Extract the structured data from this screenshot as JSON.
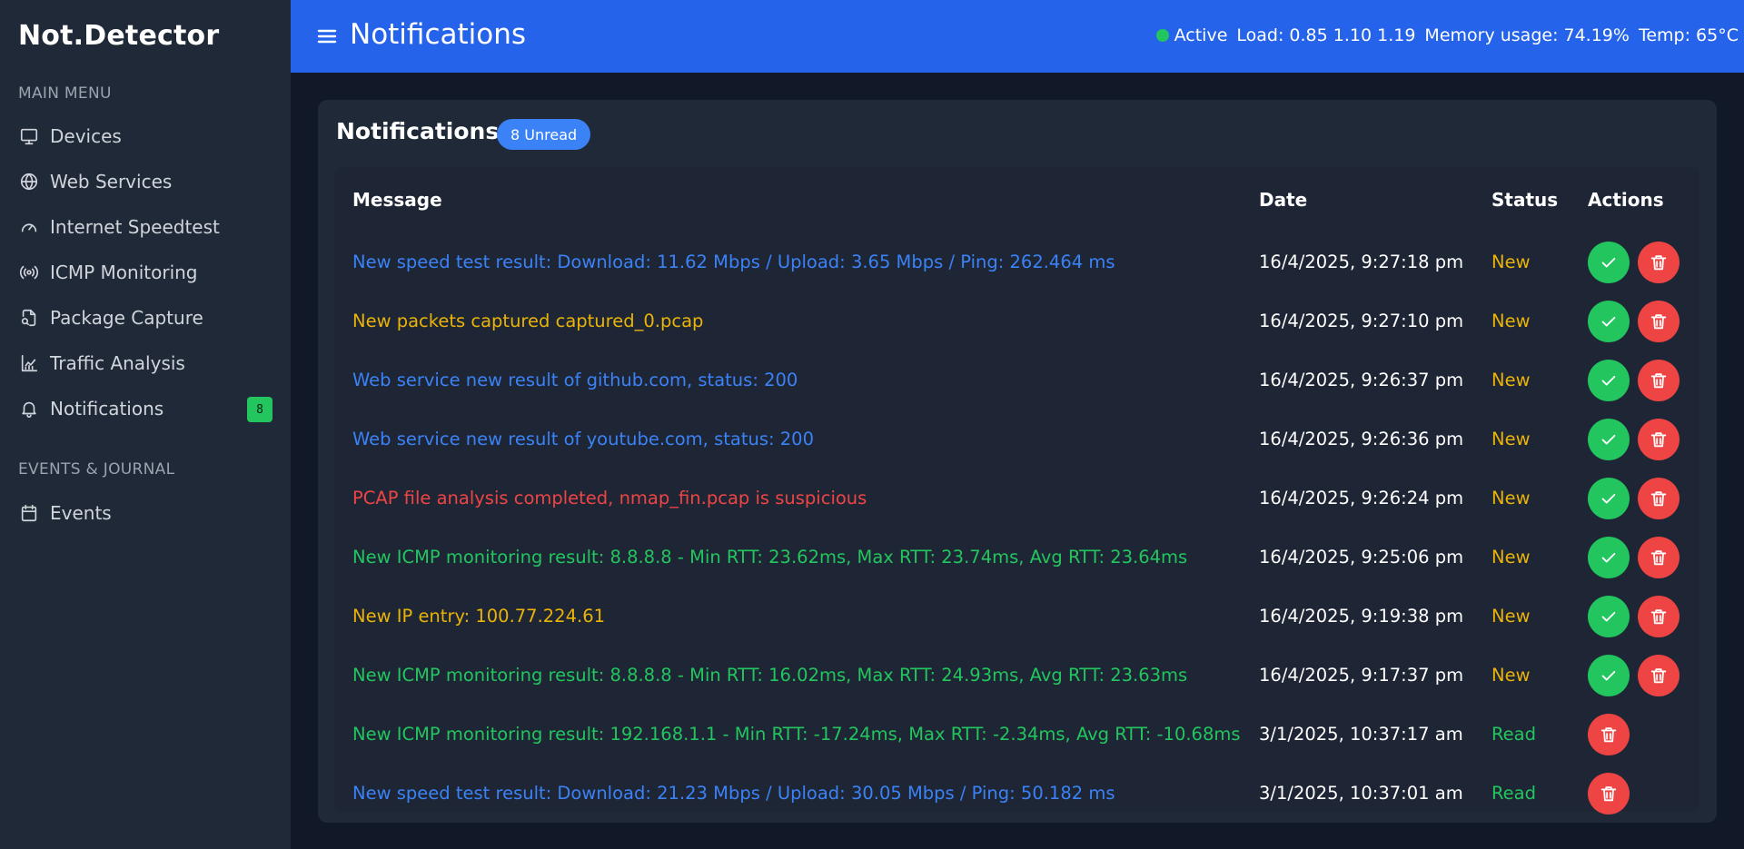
{
  "app": {
    "brand": "Not.Detector"
  },
  "sidebar": {
    "main_menu_title": "MAIN MENU",
    "items": [
      {
        "label": "Devices",
        "icon": "monitor-icon"
      },
      {
        "label": "Web Services",
        "icon": "globe-icon"
      },
      {
        "label": "Internet Speedtest",
        "icon": "gauge-icon"
      },
      {
        "label": "ICMP Monitoring",
        "icon": "broadcast-icon"
      },
      {
        "label": "Package Capture",
        "icon": "file-search-icon"
      },
      {
        "label": "Traffic Analysis",
        "icon": "chart-icon"
      },
      {
        "label": "Notifications",
        "icon": "bell-icon",
        "badge": "8"
      }
    ],
    "events_title": "EVENTS & JOURNAL",
    "events_items": [
      {
        "label": "Events",
        "icon": "calendar-icon"
      }
    ]
  },
  "header": {
    "title": "Notifications",
    "status": "Active",
    "status_color": "#22c55e",
    "load": "Load: 0.85 1.10 1.19",
    "memory": "Memory usage: 74.19%",
    "temp": "Temp: 65°C"
  },
  "card": {
    "title": "Notifications",
    "unread_badge": "8 Unread"
  },
  "table": {
    "columns": [
      "Message",
      "Date",
      "Status",
      "Actions"
    ],
    "rows": [
      {
        "message": "New speed test result: Download: 11.62 Mbps / Upload: 3.65 Mbps / Ping: 262.464 ms",
        "type": "blue",
        "date": "16/4/2025, 9:27:18 pm",
        "status": "New"
      },
      {
        "message": "New packets captured captured_0.pcap",
        "type": "yellow",
        "date": "16/4/2025, 9:27:10 pm",
        "status": "New"
      },
      {
        "message": "Web service new result of github.com, status: 200",
        "type": "blue",
        "date": "16/4/2025, 9:26:37 pm",
        "status": "New"
      },
      {
        "message": "Web service new result of youtube.com, status: 200",
        "type": "blue",
        "date": "16/4/2025, 9:26:36 pm",
        "status": "New"
      },
      {
        "message": "PCAP file analysis completed, nmap_fin.pcap is suspicious",
        "type": "red",
        "date": "16/4/2025, 9:26:24 pm",
        "status": "New"
      },
      {
        "message": "New ICMP monitoring result: 8.8.8.8 - Min RTT: 23.62ms, Max RTT: 23.74ms, Avg RTT: 23.64ms",
        "type": "green",
        "date": "16/4/2025, 9:25:06 pm",
        "status": "New"
      },
      {
        "message": "New IP entry: 100.77.224.61",
        "type": "yellow",
        "date": "16/4/2025, 9:19:38 pm",
        "status": "New"
      },
      {
        "message": "New ICMP monitoring result: 8.8.8.8 - Min RTT: 16.02ms, Max RTT: 24.93ms, Avg RTT: 23.63ms",
        "type": "green",
        "date": "16/4/2025, 9:17:37 pm",
        "status": "New"
      },
      {
        "message": "New ICMP monitoring result: 192.168.1.1 - Min RTT: -17.24ms, Max RTT: -2.34ms, Avg RTT: -10.68ms",
        "type": "green",
        "date": "3/1/2025, 10:37:17 am",
        "status": "Read"
      },
      {
        "message": "New speed test result: Download: 21.23 Mbps / Upload: 30.05 Mbps / Ping: 50.182 ms",
        "type": "blue",
        "date": "3/1/2025, 10:37:01 am",
        "status": "Read"
      }
    ]
  },
  "colors": {
    "header_bg": "#2563eb",
    "sidebar_bg": "#1f2937",
    "page_bg": "#111827",
    "msg_blue": "#3b82f6",
    "msg_yellow": "#eab308",
    "msg_red": "#ef4444",
    "msg_green": "#22c55e"
  }
}
